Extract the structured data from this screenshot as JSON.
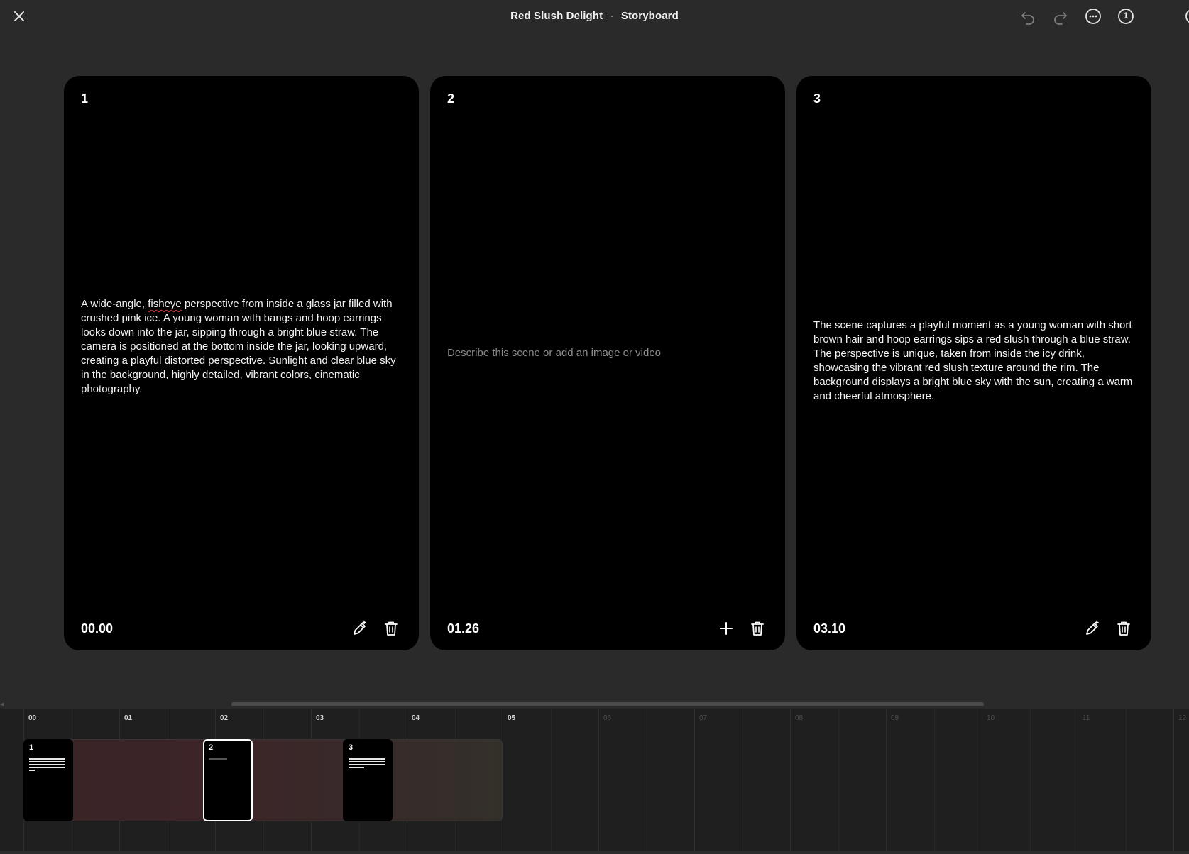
{
  "header": {
    "project_title": "Red Slush Delight",
    "separator": "·",
    "view_title": "Storyboard",
    "info_badge": "1"
  },
  "scenes": [
    {
      "number": "1",
      "description_a": "A wide-angle, ",
      "description_b": "fisheye",
      "description_c": " perspective from inside a glass jar filled with crushed pink ice. A young woman with bangs and hoop earrings looks down into the jar, sipping through a bright blue straw. The camera is positioned at the bottom inside the jar, looking upward, creating a playful distorted perspective. Sunlight and clear blue sky in the background, highly detailed, vibrant colors, cinematic photography.",
      "timestamp": "00.00"
    },
    {
      "number": "2",
      "placeholder_text": "Describe this scene or ",
      "placeholder_link": "add an image or video",
      "timestamp": "01.26"
    },
    {
      "number": "3",
      "description": "The scene captures a playful moment as a young woman with short brown hair and hoop earrings sips a red slush through a blue straw. The perspective is unique, taken from inside the icy drink, showcasing the vibrant red slush texture around the rim. The background displays a bright blue sky with the sun, creating a warm and cheerful atmosphere.",
      "timestamp": "03.10"
    }
  ],
  "timeline": {
    "ticks": [
      "00",
      "01",
      "02",
      "03",
      "04",
      "05",
      "06",
      "07",
      "08",
      "09",
      "10",
      "11",
      "12"
    ],
    "clips": [
      "1",
      "2",
      "3"
    ],
    "selected_clip": "2"
  },
  "icons": {
    "close": "close-icon",
    "undo": "undo-icon",
    "redo": "redo-icon",
    "more": "more-icon",
    "info": "info-icon",
    "edit": "edit-icon",
    "delete": "trash-icon",
    "add": "plus-icon"
  },
  "colors": {
    "background": "#2a2a2a",
    "card": "#000000",
    "timeline": "#1f1f1f",
    "track": "#3a2326",
    "spellcheck": "#dd3333"
  }
}
